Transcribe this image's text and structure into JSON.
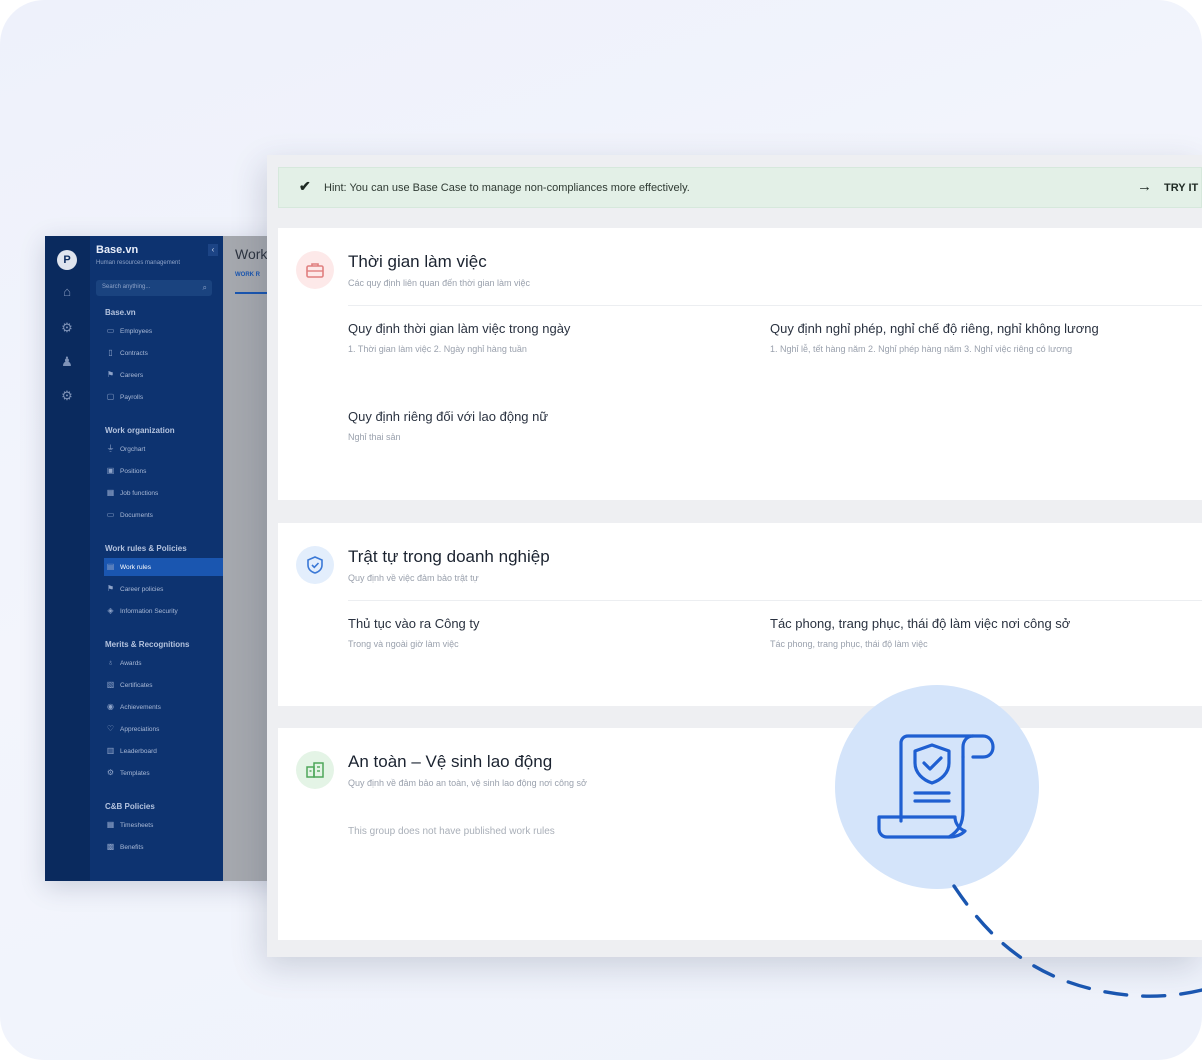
{
  "back_app": {
    "brand": "Base.vn",
    "brand_sub": "Human resources management",
    "search_placeholder": "Search anything...",
    "header_title": "Work",
    "header_tab": "WORK R",
    "groups": [
      {
        "label": "Base.vn",
        "items": [
          {
            "label": "Employees",
            "icon": "id-card-icon"
          },
          {
            "label": "Contracts",
            "icon": "document-icon"
          },
          {
            "label": "Careers",
            "icon": "flag-icon"
          },
          {
            "label": "Payrolls",
            "icon": "wallet-icon"
          }
        ]
      },
      {
        "label": "Work organization",
        "items": [
          {
            "label": "Orgchart",
            "icon": "orgchart-icon"
          },
          {
            "label": "Positions",
            "icon": "briefcase-icon"
          },
          {
            "label": "Job functions",
            "icon": "calendar-icon"
          },
          {
            "label": "Documents",
            "icon": "folder-icon"
          }
        ]
      },
      {
        "label": "Work rules & Policies",
        "items": [
          {
            "label": "Work rules",
            "icon": "book-icon",
            "active": true
          },
          {
            "label": "Career policies",
            "icon": "flag-icon"
          },
          {
            "label": "Information Security",
            "icon": "shield-icon"
          }
        ]
      },
      {
        "label": "Merits & Recognitions",
        "items": [
          {
            "label": "Awards",
            "icon": "trophy-icon"
          },
          {
            "label": "Certificates",
            "icon": "certificate-icon"
          },
          {
            "label": "Achievements",
            "icon": "medal-icon"
          },
          {
            "label": "Appreciations",
            "icon": "heart-icon"
          },
          {
            "label": "Leaderboard",
            "icon": "board-icon"
          },
          {
            "label": "Templates",
            "icon": "gear-icon"
          }
        ]
      },
      {
        "label": "C&B Policies",
        "items": [
          {
            "label": "Timesheets",
            "icon": "calendar-icon"
          },
          {
            "label": "Benefits",
            "icon": "gift-icon"
          }
        ]
      }
    ]
  },
  "hint": {
    "text": "Hint: You can use Base Case to manage non-compliances more effectively.",
    "action": "TRY IT"
  },
  "sections": [
    {
      "title": "Thời gian làm việc",
      "subtitle": "Các quy định liên quan đến thời gian làm việc",
      "icon": "briefcase-icon",
      "rules": [
        {
          "title": "Quy định thời gian làm việc trong ngày",
          "subtitle": "1. Thời gian làm việc 2. Ngày nghỉ hàng tuần"
        },
        {
          "title": "Quy định nghỉ phép, nghỉ chế độ riêng, nghỉ không lương",
          "subtitle": "1. Nghỉ lễ, tết hàng năm 2. Nghỉ phép hàng năm 3. Nghỉ việc riêng có lương"
        },
        {
          "title": "Quy định riêng đối với lao động nữ",
          "subtitle": "Nghỉ thai sản"
        }
      ]
    },
    {
      "title": "Trật tự trong doanh nghiệp",
      "subtitle": "Quy định về việc đảm bảo trật tự",
      "icon": "shield-icon",
      "rules": [
        {
          "title": "Thủ tục vào ra Công ty",
          "subtitle": "Trong và ngoài giờ làm việc"
        },
        {
          "title": "Tác phong, trang phục, thái độ làm việc nơi công sở",
          "subtitle": "Tác phong, trang phục, thái độ làm việc"
        }
      ]
    },
    {
      "title": "An toàn – Vệ sinh lao động",
      "subtitle": "Quy định về đảm bảo an toàn, vệ sinh lao động nơi công sở",
      "icon": "building-icon",
      "empty_text": "This group does not have published work rules"
    }
  ],
  "colors": {
    "sidebar": "#0d3370",
    "rail": "#0a2a5e",
    "accent": "#1a56b0",
    "hint_bg": "#e3f0e7",
    "illustration": "#1f5fd1"
  }
}
